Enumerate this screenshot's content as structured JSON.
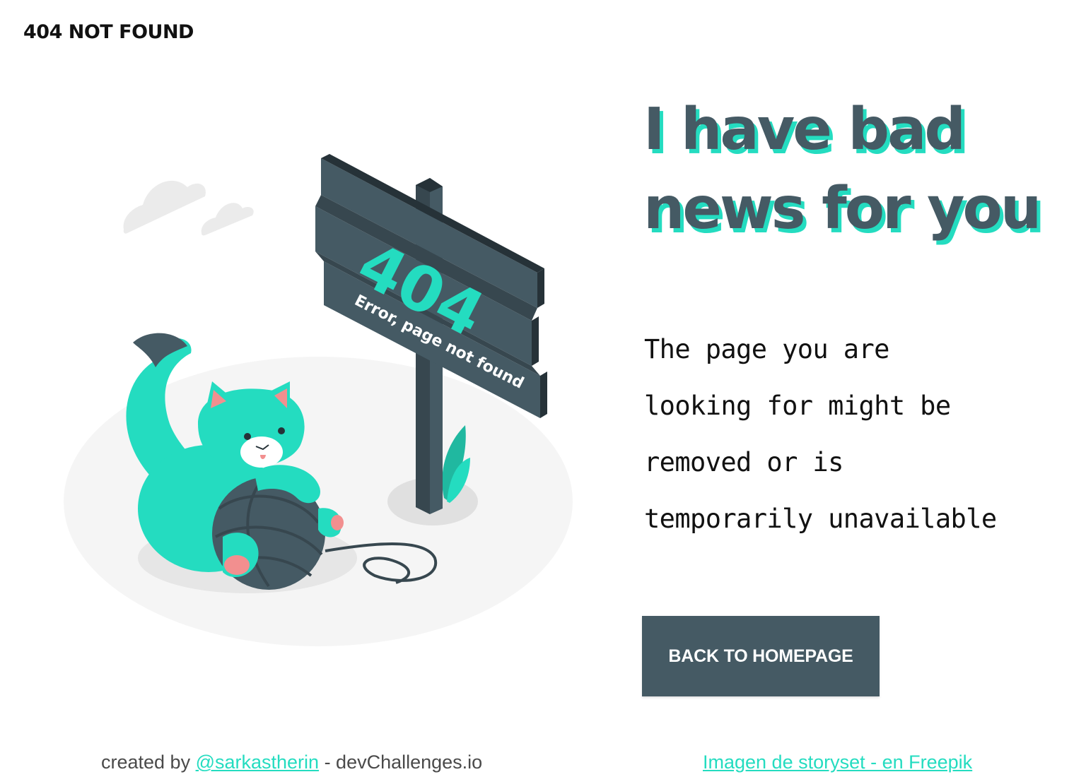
{
  "header": {
    "title": "404 NOT FOUND"
  },
  "illustration": {
    "sign_code": "404",
    "sign_text": "Error, page not found"
  },
  "main": {
    "heading_lines": [
      "I have bad",
      "news for you"
    ],
    "message_lines": [
      "The page you are",
      "looking for might be",
      "removed or is",
      "temporarily unavailable"
    ],
    "button_label": "BACK TO HOMEPAGE"
  },
  "footer": {
    "credit_prefix": "created by ",
    "credit_link": "@sarkastherin",
    "credit_suffix": " - devChallenges.io",
    "attribution_link": "Imagen de storyset - en Freepik"
  },
  "colors": {
    "accent": "#24DCC0",
    "dark": "#455A64",
    "text": "#111111"
  },
  "icons": [
    "cat-illustration",
    "signpost-illustration",
    "yarn-ball-illustration",
    "cloud-icon",
    "plant-icon"
  ]
}
